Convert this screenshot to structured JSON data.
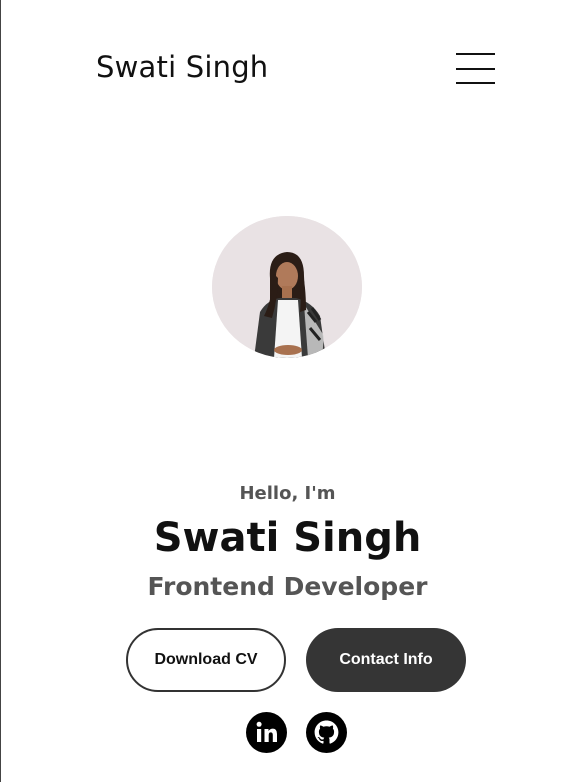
{
  "header": {
    "logo_text": "Swati Singh"
  },
  "hero": {
    "greeting": "Hello, I'm",
    "name": "Swati Singh",
    "role": "Frontend Developer"
  },
  "buttons": {
    "download_cv": "Download CV",
    "contact_info": "Contact Info"
  },
  "social": {
    "icons": [
      "linkedin-icon",
      "github-icon"
    ]
  },
  "colors": {
    "text": "#111111",
    "muted": "#555555",
    "button_dark": "#353535",
    "avatar_bg": "#e9e2e4"
  }
}
